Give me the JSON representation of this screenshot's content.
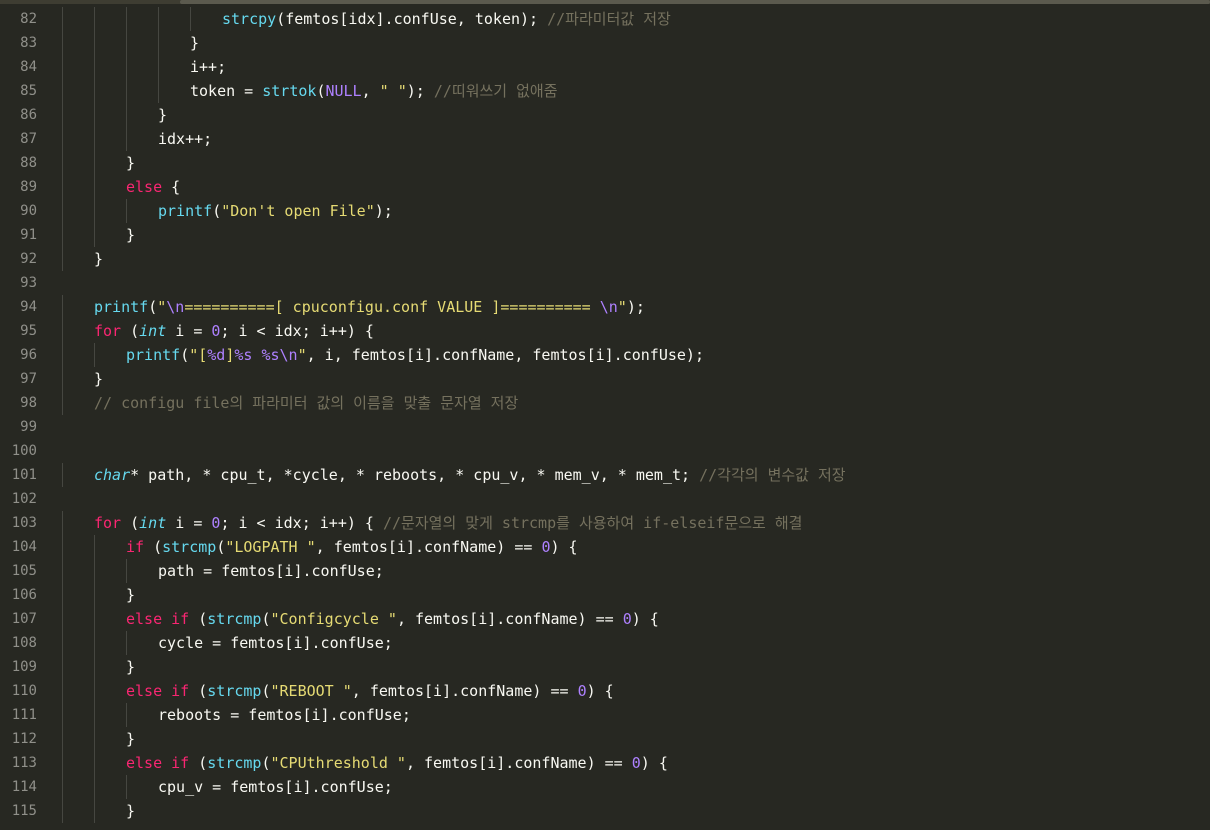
{
  "colors": {
    "background": "#272822",
    "foreground": "#f8f8f2",
    "gutter": "#90908a",
    "keyword": "#f92672",
    "function": "#66d9ef",
    "string": "#e6db74",
    "number": "#ae81ff",
    "comment": "#75715e",
    "indent_guide": "#464741"
  },
  "lines": [
    {
      "n": "82",
      "indent": 5,
      "tokens": [
        [
          "fn",
          "strcpy"
        ],
        [
          "plain",
          "(femtos[idx].confUse, token); "
        ],
        [
          "cm",
          "//파라미터값 저장"
        ]
      ]
    },
    {
      "n": "83",
      "indent": 4,
      "tokens": [
        [
          "plain",
          "}"
        ]
      ]
    },
    {
      "n": "84",
      "indent": 4,
      "tokens": [
        [
          "plain",
          "i++;"
        ]
      ]
    },
    {
      "n": "85",
      "indent": 4,
      "tokens": [
        [
          "plain",
          "token = "
        ],
        [
          "fn",
          "strtok"
        ],
        [
          "plain",
          "("
        ],
        [
          "num",
          "NULL"
        ],
        [
          "plain",
          ", "
        ],
        [
          "str",
          "\" \""
        ],
        [
          "plain",
          "); "
        ],
        [
          "cm",
          "//띠워쓰기 없애줌"
        ]
      ]
    },
    {
      "n": "86",
      "indent": 3,
      "tokens": [
        [
          "plain",
          "}"
        ]
      ]
    },
    {
      "n": "87",
      "indent": 3,
      "tokens": [
        [
          "plain",
          "idx++;"
        ]
      ]
    },
    {
      "n": "88",
      "indent": 2,
      "tokens": [
        [
          "plain",
          "}"
        ]
      ]
    },
    {
      "n": "89",
      "indent": 2,
      "tokens": [
        [
          "kw",
          "else"
        ],
        [
          "plain",
          " {"
        ]
      ]
    },
    {
      "n": "90",
      "indent": 3,
      "tokens": [
        [
          "fn",
          "printf"
        ],
        [
          "plain",
          "("
        ],
        [
          "str",
          "\"Don't open File\""
        ],
        [
          "plain",
          ");"
        ]
      ]
    },
    {
      "n": "91",
      "indent": 2,
      "tokens": [
        [
          "plain",
          "}"
        ]
      ]
    },
    {
      "n": "92",
      "indent": 1,
      "tokens": [
        [
          "plain",
          "}"
        ]
      ]
    },
    {
      "n": "93",
      "indent": 0,
      "tokens": []
    },
    {
      "n": "94",
      "indent": 1,
      "tokens": [
        [
          "fn",
          "printf"
        ],
        [
          "plain",
          "("
        ],
        [
          "str",
          "\""
        ],
        [
          "esc",
          "\\n"
        ],
        [
          "str",
          "==========[ cpuconfigu.conf VALUE ]========== "
        ],
        [
          "esc",
          "\\n"
        ],
        [
          "str",
          "\""
        ],
        [
          "plain",
          ");"
        ]
      ]
    },
    {
      "n": "95",
      "indent": 1,
      "tokens": [
        [
          "kw",
          "for"
        ],
        [
          "plain",
          " ("
        ],
        [
          "ty",
          "int"
        ],
        [
          "plain",
          " i = "
        ],
        [
          "num",
          "0"
        ],
        [
          "plain",
          "; i < idx; i++) {"
        ]
      ]
    },
    {
      "n": "96",
      "indent": 2,
      "tokens": [
        [
          "fn",
          "printf"
        ],
        [
          "plain",
          "("
        ],
        [
          "str",
          "\"["
        ],
        [
          "esc",
          "%d"
        ],
        [
          "str",
          "]"
        ],
        [
          "esc",
          "%s"
        ],
        [
          "str",
          " "
        ],
        [
          "esc",
          "%s"
        ],
        [
          "esc",
          "\\n"
        ],
        [
          "str",
          "\""
        ],
        [
          "plain",
          ", i, femtos[i].confName, femtos[i].confUse);"
        ]
      ]
    },
    {
      "n": "97",
      "indent": 1,
      "tokens": [
        [
          "plain",
          "}"
        ]
      ]
    },
    {
      "n": "98",
      "indent": 1,
      "tokens": [
        [
          "cm",
          "// configu file의 파라미터 값의 이름을 맞출 문자열 저장"
        ]
      ]
    },
    {
      "n": "99",
      "indent": 0,
      "tokens": []
    },
    {
      "n": "100",
      "indent": 0,
      "tokens": []
    },
    {
      "n": "101",
      "indent": 1,
      "tokens": [
        [
          "ty",
          "char"
        ],
        [
          "plain",
          "* path, * cpu_t, *cycle, * reboots, * cpu_v, * mem_v, * mem_t; "
        ],
        [
          "cm",
          "//각각의 변수값 저장"
        ]
      ]
    },
    {
      "n": "102",
      "indent": 0,
      "tokens": []
    },
    {
      "n": "103",
      "indent": 1,
      "tokens": [
        [
          "kw",
          "for"
        ],
        [
          "plain",
          " ("
        ],
        [
          "ty",
          "int"
        ],
        [
          "plain",
          " i = "
        ],
        [
          "num",
          "0"
        ],
        [
          "plain",
          "; i < idx; i++) { "
        ],
        [
          "cm",
          "//문자열의 맞게 strcmp를 사용하여 if-elseif문으로 해결"
        ]
      ]
    },
    {
      "n": "104",
      "indent": 2,
      "tokens": [
        [
          "kw",
          "if"
        ],
        [
          "plain",
          " ("
        ],
        [
          "fn",
          "strcmp"
        ],
        [
          "plain",
          "("
        ],
        [
          "str",
          "\"LOGPATH \""
        ],
        [
          "plain",
          ", femtos[i].confName) == "
        ],
        [
          "num",
          "0"
        ],
        [
          "plain",
          ") {"
        ]
      ]
    },
    {
      "n": "105",
      "indent": 3,
      "tokens": [
        [
          "plain",
          "path = femtos[i].confUse;"
        ]
      ]
    },
    {
      "n": "106",
      "indent": 2,
      "tokens": [
        [
          "plain",
          "}"
        ]
      ]
    },
    {
      "n": "107",
      "indent": 2,
      "tokens": [
        [
          "kw",
          "else"
        ],
        [
          "plain",
          " "
        ],
        [
          "kw",
          "if"
        ],
        [
          "plain",
          " ("
        ],
        [
          "fn",
          "strcmp"
        ],
        [
          "plain",
          "("
        ],
        [
          "str",
          "\"Configcycle \""
        ],
        [
          "plain",
          ", femtos[i].confName) == "
        ],
        [
          "num",
          "0"
        ],
        [
          "plain",
          ") {"
        ]
      ]
    },
    {
      "n": "108",
      "indent": 3,
      "tokens": [
        [
          "plain",
          "cycle = femtos[i].confUse;"
        ]
      ]
    },
    {
      "n": "109",
      "indent": 2,
      "tokens": [
        [
          "plain",
          "}"
        ]
      ]
    },
    {
      "n": "110",
      "indent": 2,
      "tokens": [
        [
          "kw",
          "else"
        ],
        [
          "plain",
          " "
        ],
        [
          "kw",
          "if"
        ],
        [
          "plain",
          " ("
        ],
        [
          "fn",
          "strcmp"
        ],
        [
          "plain",
          "("
        ],
        [
          "str",
          "\"REBOOT \""
        ],
        [
          "plain",
          ", femtos[i].confName) == "
        ],
        [
          "num",
          "0"
        ],
        [
          "plain",
          ") {"
        ]
      ]
    },
    {
      "n": "111",
      "indent": 3,
      "tokens": [
        [
          "plain",
          "reboots = femtos[i].confUse;"
        ]
      ]
    },
    {
      "n": "112",
      "indent": 2,
      "tokens": [
        [
          "plain",
          "}"
        ]
      ]
    },
    {
      "n": "113",
      "indent": 2,
      "tokens": [
        [
          "kw",
          "else"
        ],
        [
          "plain",
          " "
        ],
        [
          "kw",
          "if"
        ],
        [
          "plain",
          " ("
        ],
        [
          "fn",
          "strcmp"
        ],
        [
          "plain",
          "("
        ],
        [
          "str",
          "\"CPUthreshold \""
        ],
        [
          "plain",
          ", femtos[i].confName) == "
        ],
        [
          "num",
          "0"
        ],
        [
          "plain",
          ") {"
        ]
      ]
    },
    {
      "n": "114",
      "indent": 3,
      "tokens": [
        [
          "plain",
          "cpu_v = femtos[i].confUse;"
        ]
      ]
    },
    {
      "n": "115",
      "indent": 2,
      "tokens": [
        [
          "plain",
          "}"
        ]
      ]
    }
  ]
}
